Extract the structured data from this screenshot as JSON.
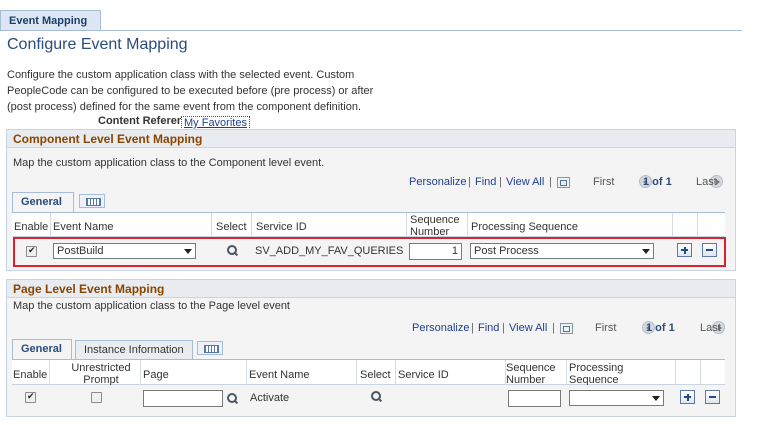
{
  "top_tab": "Event Mapping",
  "page_title": "Configure Event Mapping",
  "description": "Configure the custom application class with the selected event. Custom PeopleCode can be configured to be executed before (pre process) or after (post process) defined for the same event from the component definition.",
  "content_reference": {
    "label": "Content Reference",
    "value": "My Favorites"
  },
  "component_section": {
    "title": "Component Level Event Mapping",
    "description": "Map the custom application class to the Component level event.",
    "toolbar": {
      "personalize": "Personalize",
      "find": "Find",
      "view_all": "View All",
      "first": "First",
      "page_info": "1 of 1",
      "last": "Last"
    },
    "tabs": [
      "General"
    ],
    "columns": {
      "enable": "Enable",
      "event_name": "Event Name",
      "select": "Select",
      "service_id": "Service ID",
      "sequence_number": "Sequence Number",
      "processing_sequence": "Processing Sequence"
    },
    "row": {
      "enabled": true,
      "event_name": "PostBuild",
      "service_id": "SV_ADD_MY_FAV_QUERIES",
      "sequence_number": "1",
      "processing_sequence": "Post Process"
    }
  },
  "page_section": {
    "title": "Page Level Event Mapping",
    "description": "Map the custom application class to the Page level event",
    "toolbar": {
      "personalize": "Personalize",
      "find": "Find",
      "view_all": "View All",
      "first": "First",
      "page_info": "1 of 1",
      "last": "Last"
    },
    "tabs": [
      "General",
      "Instance Information"
    ],
    "columns": {
      "enable": "Enable",
      "unrestricted_prompt": "Unrestricted Prompt",
      "page": "Page",
      "event_name": "Event Name",
      "select": "Select",
      "service_id": "Service ID",
      "sequence_number": "Sequence Number",
      "processing_sequence": "Processing Sequence"
    },
    "row": {
      "enabled": true,
      "unrestricted_prompt": false,
      "page": "",
      "event_name": "Activate",
      "service_id": "",
      "sequence_number": "",
      "processing_sequence": ""
    }
  },
  "colors": {
    "section_title": "#8a4600",
    "link": "#1f3f8f",
    "highlight": "#d9232e"
  }
}
